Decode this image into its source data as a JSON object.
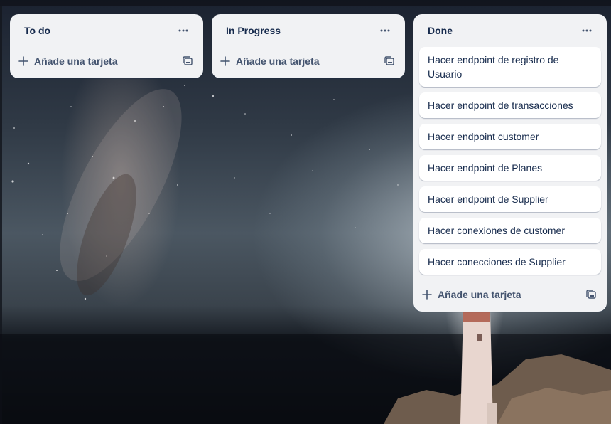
{
  "colors": {
    "list_bg": "#f1f2f4",
    "card_bg": "#ffffff",
    "text_primary": "#172b4d",
    "text_secondary": "#44546f"
  },
  "lists": [
    {
      "title": "To do",
      "menu_icon": "ellipsis-icon",
      "cards": [],
      "add_card_label": "Añade una tarjeta",
      "add_icon": "plus-icon",
      "template_icon": "card-template-icon"
    },
    {
      "title": "In Progress",
      "menu_icon": "ellipsis-icon",
      "cards": [],
      "add_card_label": "Añade una tarjeta",
      "add_icon": "plus-icon",
      "template_icon": "card-template-icon"
    },
    {
      "title": "Done",
      "menu_icon": "ellipsis-icon",
      "cards": [
        "Hacer endpoint de registro de Usuario",
        "Hacer endpoint de transacciones",
        "Hacer endpoint customer",
        "Hacer endpoint de Planes",
        "Hacer endpoint de Supplier",
        "Hacer conexiones de customer",
        "Hacer conecciones de Supplier"
      ],
      "add_card_label": "Añade una tarjeta",
      "add_icon": "plus-icon",
      "template_icon": "card-template-icon"
    }
  ]
}
